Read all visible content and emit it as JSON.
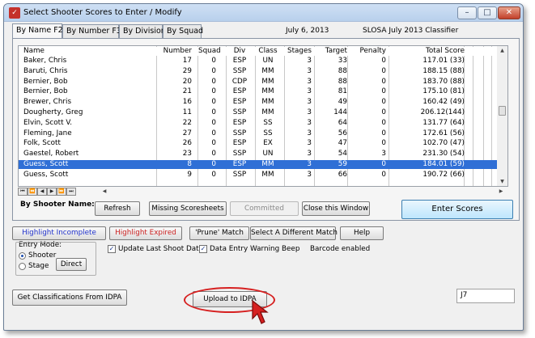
{
  "window": {
    "title": "Select Shooter Scores to Enter / Modify",
    "icon_glyph": "✓",
    "controls": {
      "minimize": "–",
      "maximize": "□",
      "close": "✕"
    }
  },
  "tabs": [
    "By Name F2",
    "By Number F3",
    "By Division",
    "By Squad"
  ],
  "header": {
    "date": "July  6, 2013",
    "match_name": "SLOSA July 2013 Classifier"
  },
  "table": {
    "columns": [
      "Name",
      "Number",
      "Squad",
      "Div",
      "Class",
      "Stages",
      "Target",
      "Penalty",
      "Total Score"
    ],
    "rows": [
      [
        "Baker, Chris",
        "17",
        "0",
        "ESP",
        "UN",
        "3",
        "33",
        "0",
        "117.01 (33)"
      ],
      [
        "Baruti, Chris",
        "29",
        "0",
        "SSP",
        "MM",
        "3",
        "88",
        "0",
        "188.15 (88)"
      ],
      [
        "Bernier, Bob",
        "20",
        "0",
        "CDP",
        "MM",
        "3",
        "88",
        "0",
        "183.70 (88)"
      ],
      [
        "Bernier, Bob",
        "21",
        "0",
        "ESP",
        "MM",
        "3",
        "81",
        "0",
        "175.10 (81)"
      ],
      [
        "Brewer, Chris",
        "16",
        "0",
        "ESP",
        "MM",
        "3",
        "49",
        "0",
        "160.42 (49)"
      ],
      [
        "Dougherty, Greg",
        "11",
        "0",
        "SSP",
        "MM",
        "3",
        "144",
        "0",
        "206.12(144)"
      ],
      [
        "Elvin, Scott V.",
        "22",
        "0",
        "ESP",
        "SS",
        "3",
        "64",
        "0",
        "131.77 (64)"
      ],
      [
        "Fleming, Jane",
        "27",
        "0",
        "SSP",
        "SS",
        "3",
        "56",
        "0",
        "172.61 (56)"
      ],
      [
        "Folk, Scott",
        "26",
        "0",
        "ESP",
        "EX",
        "3",
        "47",
        "0",
        "102.70 (47)"
      ],
      [
        "Gaestel, Robert",
        "23",
        "0",
        "SSP",
        "UN",
        "3",
        "54",
        "3",
        "231.30 (54)"
      ],
      [
        "Guess, Scott",
        "8",
        "0",
        "ESP",
        "MM",
        "3",
        "59",
        "0",
        "184.01 (59)"
      ],
      [
        "Guess, Scott",
        "9",
        "0",
        "SSP",
        "MM",
        "3",
        "66",
        "0",
        "190.72 (66)"
      ]
    ],
    "selected_row_index": 10
  },
  "nav_buttons": [
    "⏮",
    "⏪",
    "◀",
    "▶",
    "⏩",
    "⏭"
  ],
  "labels": {
    "by_shooter_name": "By Shooter Name:",
    "entry_mode": "Entry Mode:",
    "barcode": "Barcode enabled"
  },
  "buttons": {
    "refresh": "Refresh",
    "missing_scoresheets": "Missing Scoresheets",
    "committed": "Committed",
    "close_window": "Close this Window",
    "enter_scores": "Enter Scores",
    "highlight_incomplete": "Highlight Incomplete",
    "highlight_expired": "Highlight Expired",
    "prune_match": "'Prune' Match",
    "select_different_match": "Select A Different  Match",
    "help": "Help",
    "direct": "Direct",
    "get_classifications": "Get Classifications From IDPA",
    "upload": "Upload to IDPA"
  },
  "entry_mode": {
    "options": [
      "Shooter",
      "Stage"
    ],
    "selected": "Shooter"
  },
  "checkboxes": {
    "update_last_shoot_date": {
      "label": "Update Last Shoot Date",
      "checked": true
    },
    "data_entry_warning_beep": {
      "label": "Data Entry Warning Beep",
      "checked": true
    }
  },
  "field_value": "J7",
  "colors": {
    "selection": "#2f6fd6",
    "highlight_incomplete": "#2233cc",
    "highlight_expired": "#cc2222",
    "annotation": "#d62020"
  }
}
